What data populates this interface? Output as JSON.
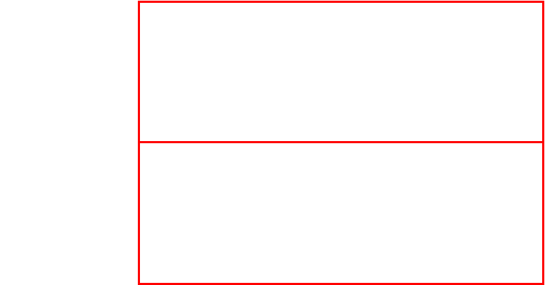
{
  "theme": {
    "background": "#ffffff",
    "outline_color": "#ff0000"
  },
  "regions": [
    {
      "name": "top",
      "label": ""
    },
    {
      "name": "bottom",
      "label": ""
    }
  ]
}
